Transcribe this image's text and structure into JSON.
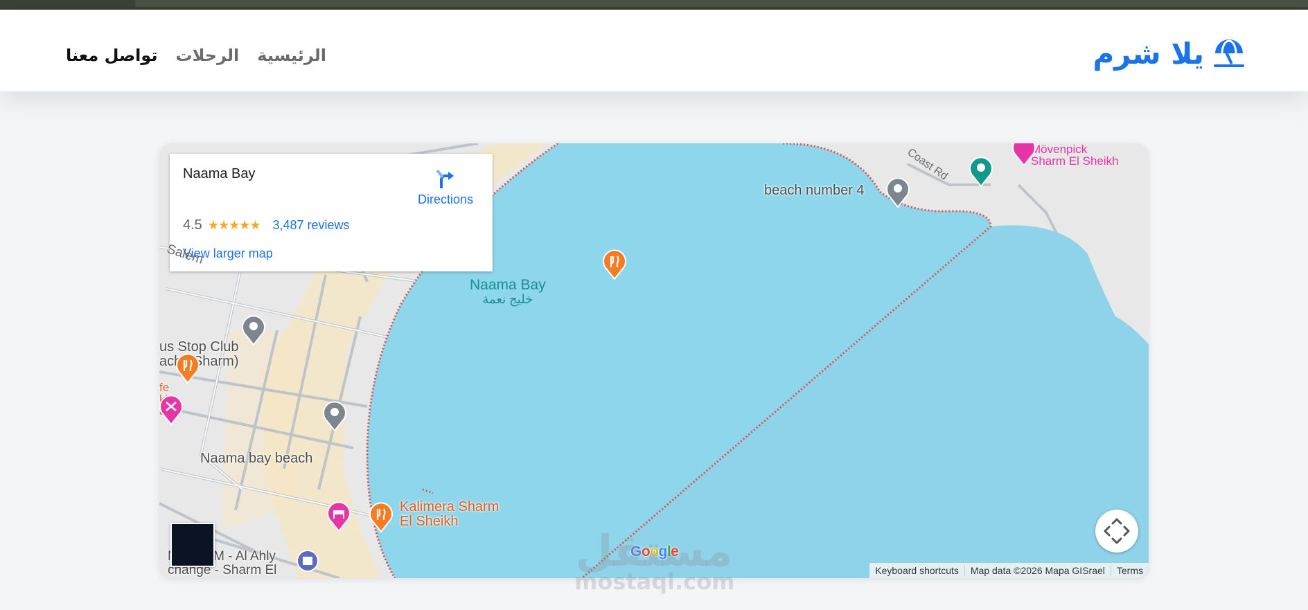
{
  "brand": {
    "name": "يلا شرم",
    "icon": "beach-umbrella-icon",
    "color": "#1a73e8"
  },
  "nav": {
    "home": "الرئيسية",
    "trips": "الرحلات",
    "contact": "تواصل معنا"
  },
  "map": {
    "info": {
      "title": "Naama Bay",
      "directions": "Directions",
      "rating": "4.5",
      "stars": "★★★★★",
      "reviews": "3,487 reviews",
      "view_larger": "View larger map"
    },
    "labels": {
      "bay_en": "Naama Bay",
      "bay_ar": "خليج نعمة",
      "beach4": "beach number 4",
      "coast_rd": "Coast Rd",
      "movenpick": "Mövenpick\nSharm El Sheikh",
      "salem": "Salem",
      "bus_stop": "us Stop Club\nacha Sharm)",
      "cafe": "fe\nkh\nafe",
      "naama_beach": "Naama bay beach",
      "kalimera": "Kalimera Sharm\nEl Sheikh",
      "atm": "NBE ATM - Al Ahly\nchange - Sharm El"
    },
    "google_logo": "Google",
    "attribution": {
      "shortcuts": "Keyboard shortcuts",
      "map_data": "Map data ©2026 Mapa GISrael",
      "terms": "Terms"
    },
    "colors": {
      "water": "#8dd6ec",
      "land": "#e8e8e8",
      "sand": "#f5e6c6",
      "boundary": "#d9534f"
    }
  },
  "watermark": {
    "ar": "مستقل",
    "en": "mostaql.com"
  }
}
